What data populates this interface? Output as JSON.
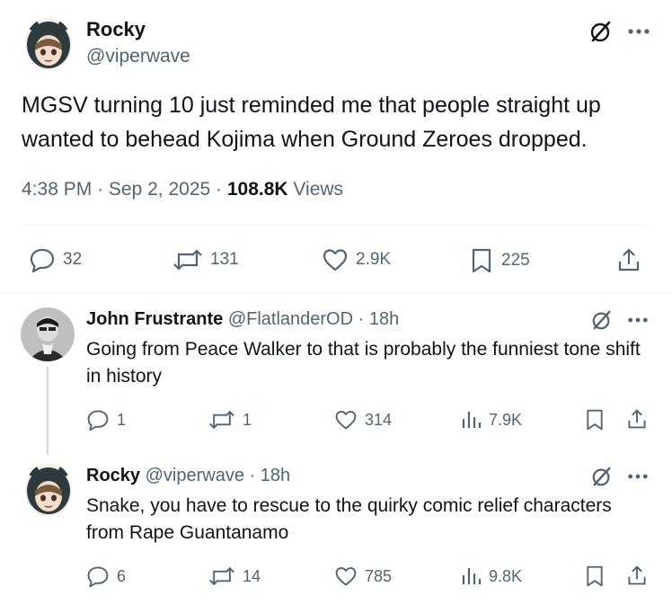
{
  "main_tweet": {
    "name": "Rocky",
    "handle": "@viperwave",
    "text": "MGSV turning 10 just reminded me that people straight up wanted to behead Kojima when Ground Zeroes dropped.",
    "time": "4:38 PM",
    "date": "Sep 2, 2025",
    "views_count": "108.8K",
    "views_label": "Views",
    "replies": "32",
    "reposts": "131",
    "likes": "2.9K",
    "bookmarks": "225",
    "sep": "·"
  },
  "replies": [
    {
      "name": "John Frustrante",
      "handle": "@FlatlanderOD",
      "time": "18h",
      "sep": "·",
      "text": "Going from Peace Walker to that is probably the funniest tone shift in history",
      "replies": "1",
      "reposts": "1",
      "likes": "314",
      "views": "7.9K"
    },
    {
      "name": "Rocky",
      "handle": "@viperwave",
      "time": "18h",
      "sep": "·",
      "text": "Snake, you have to rescue to the quirky comic relief characters from Rape Guantanamo",
      "replies": "6",
      "reposts": "14",
      "likes": "785",
      "views": "9.8K"
    }
  ],
  "icons": {
    "reply": "reply-icon",
    "repost": "repost-icon",
    "like": "like-icon",
    "bookmark": "bookmark-icon",
    "share": "share-icon",
    "views": "views-icon",
    "grok": "grok-icon",
    "more": "more-icon"
  },
  "colors": {
    "text": "#0f1419",
    "secondary": "#536471",
    "divider": "#eff3f4",
    "thread": "#cfd9de"
  }
}
